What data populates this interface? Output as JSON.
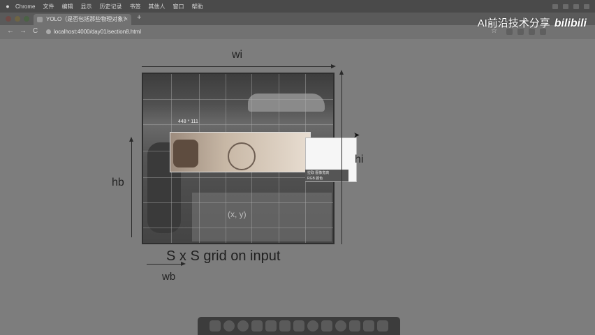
{
  "menubar": {
    "items": [
      "Chrome",
      "文件",
      "编辑",
      "显示",
      "历史记录",
      "书签",
      "其他人",
      "窗口",
      "帮助"
    ]
  },
  "browser": {
    "tab_title": "YOLO（是否包括那些物理对象？",
    "tab_close": "×",
    "new_tab": "+",
    "back": "←",
    "forward": "→",
    "reload": "C",
    "url": "localhost:4000/day01/section8.html",
    "bookmark_star": "☆"
  },
  "watermark": {
    "text": "AI前沿技术分享",
    "logo": "bilibili"
  },
  "diagram": {
    "wi_label": "wi",
    "hi_label": "hi",
    "hb_label": "hb",
    "wb_label": "wb",
    "caption": "S x S grid on input",
    "center_label": "(x, y)",
    "highlight_tag": "448 * 111",
    "popup_line1": "拉取   图像宽高",
    "popup_line2": "RGB 颜色"
  }
}
